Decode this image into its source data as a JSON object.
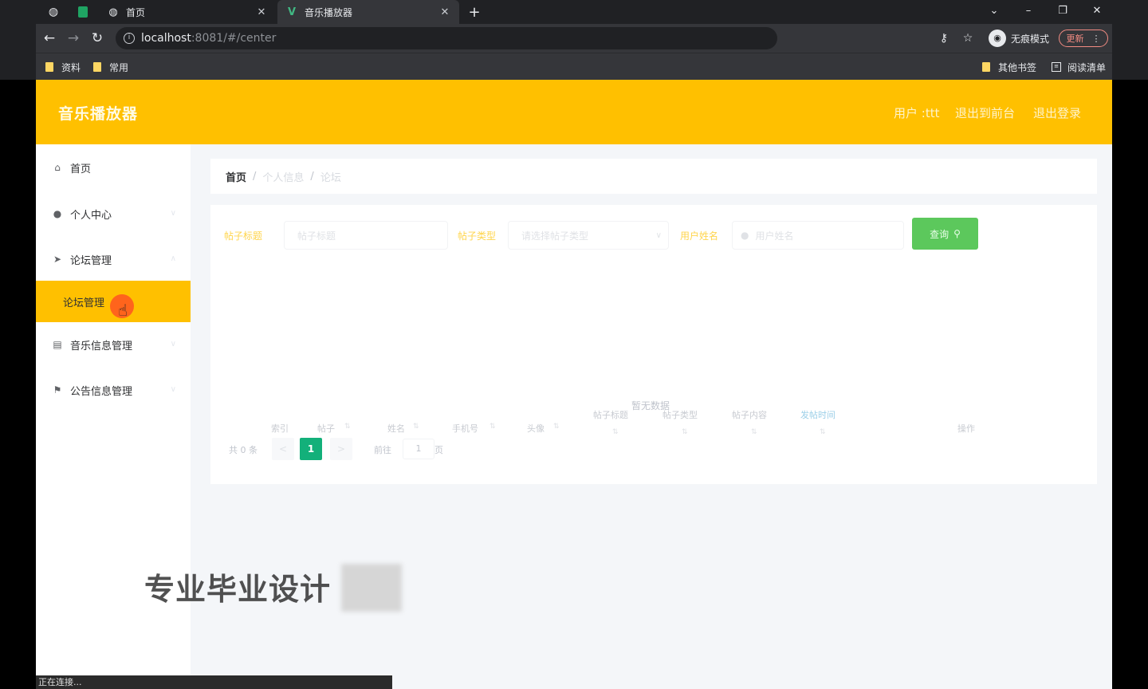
{
  "browser": {
    "tabs": [
      {
        "title": "首页",
        "favicon": "globe-icon"
      },
      {
        "title": "音乐播放器",
        "favicon": "vue-logo-icon"
      }
    ],
    "new_tab": "+",
    "url_host": "localhost",
    "url_rest": ":8081/#/center",
    "incognito_label": "无痕模式",
    "update_label": "更新",
    "bookmarks": [
      "资料",
      "常用"
    ],
    "bookmarks_right": [
      "其他书签",
      "阅读清单"
    ]
  },
  "header": {
    "brand": "音乐播放器",
    "user": "用户 :ttt",
    "back_to_front": "退出到前台",
    "logout": "退出登录"
  },
  "sidebar": {
    "items": [
      {
        "label": "首页",
        "icon": "home-icon"
      },
      {
        "label": "个人中心",
        "icon": "user-icon"
      },
      {
        "label": "论坛管理",
        "icon": "send-icon"
      },
      {
        "label": "论坛管理",
        "icon": ""
      },
      {
        "label": "音乐信息管理",
        "icon": "music-doc-icon"
      },
      {
        "label": "公告信息管理",
        "icon": "flag-icon"
      }
    ]
  },
  "breadcrumb": {
    "home": "首页",
    "sep": "/",
    "level1": "个人信息",
    "level2": "论坛"
  },
  "search": {
    "label1": "帖子标题",
    "placeholder1": "帖子标题",
    "label2": "帖子类型",
    "placeholder2": "请选择帖子类型",
    "label3": "用户姓名",
    "placeholder3": "用户姓名",
    "button": "查询"
  },
  "table": {
    "headers": [
      "索引",
      "帖子",
      "姓名",
      "手机号",
      "头像",
      "帖子标题",
      "帖子类型",
      "帖子内容",
      "发帖时间",
      "操作"
    ],
    "empty_text": "暂无数据"
  },
  "pagination": {
    "total": "共 0 条",
    "prev": "<",
    "current": "1",
    "next": ">",
    "goto": "前往",
    "page_input": "1",
    "unit": "页"
  },
  "watermark": "专业毕业设计",
  "status_text": "正在连接..."
}
